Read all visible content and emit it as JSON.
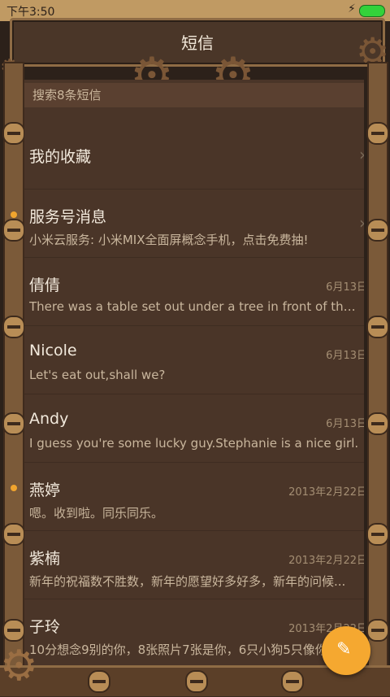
{
  "status": {
    "time": "下午3:50"
  },
  "header": {
    "title": "短信"
  },
  "search": {
    "placeholder": "搜索8条短信"
  },
  "conversations": [
    {
      "name": "我的收藏",
      "preview": "",
      "date": "",
      "chevron": true,
      "unread": false
    },
    {
      "name": "服务号消息",
      "preview": "小米云服务: 小米MIX全面屏概念手机，点击免费抽!",
      "date": "",
      "chevron": true,
      "unread": true
    },
    {
      "name": "倩倩",
      "preview": "There was a table set out under a tree in front of the ho...",
      "date": "6月13日",
      "chevron": false,
      "unread": false
    },
    {
      "name": "Nicole",
      "preview": "Let's eat out,shall we?",
      "date": "6月13日",
      "chevron": false,
      "unread": false
    },
    {
      "name": "Andy",
      "preview": "I guess you're some lucky guy.Stephanie is a nice girl.",
      "date": "6月13日",
      "chevron": false,
      "unread": false
    },
    {
      "name": "燕婷",
      "preview": "嗯。收到啦。同乐同乐。",
      "date": "2013年2月22日",
      "chevron": false,
      "unread": true
    },
    {
      "name": "紫楠",
      "preview": "新年的祝福数不胜数，新年的愿望好多好多，新年的问候...",
      "date": "2013年2月22日",
      "chevron": false,
      "unread": false
    },
    {
      "name": "子玲",
      "preview": "10分想念9别的你，8张照片7张是你，6只小狗5只像你...",
      "date": "2013年2月22日",
      "chevron": false,
      "unread": false
    }
  ],
  "colors": {
    "accent": "#f5a830",
    "theme": "#4a3528"
  },
  "icons": {
    "compose": "compose-icon",
    "chevron": "chevron-right-icon"
  }
}
